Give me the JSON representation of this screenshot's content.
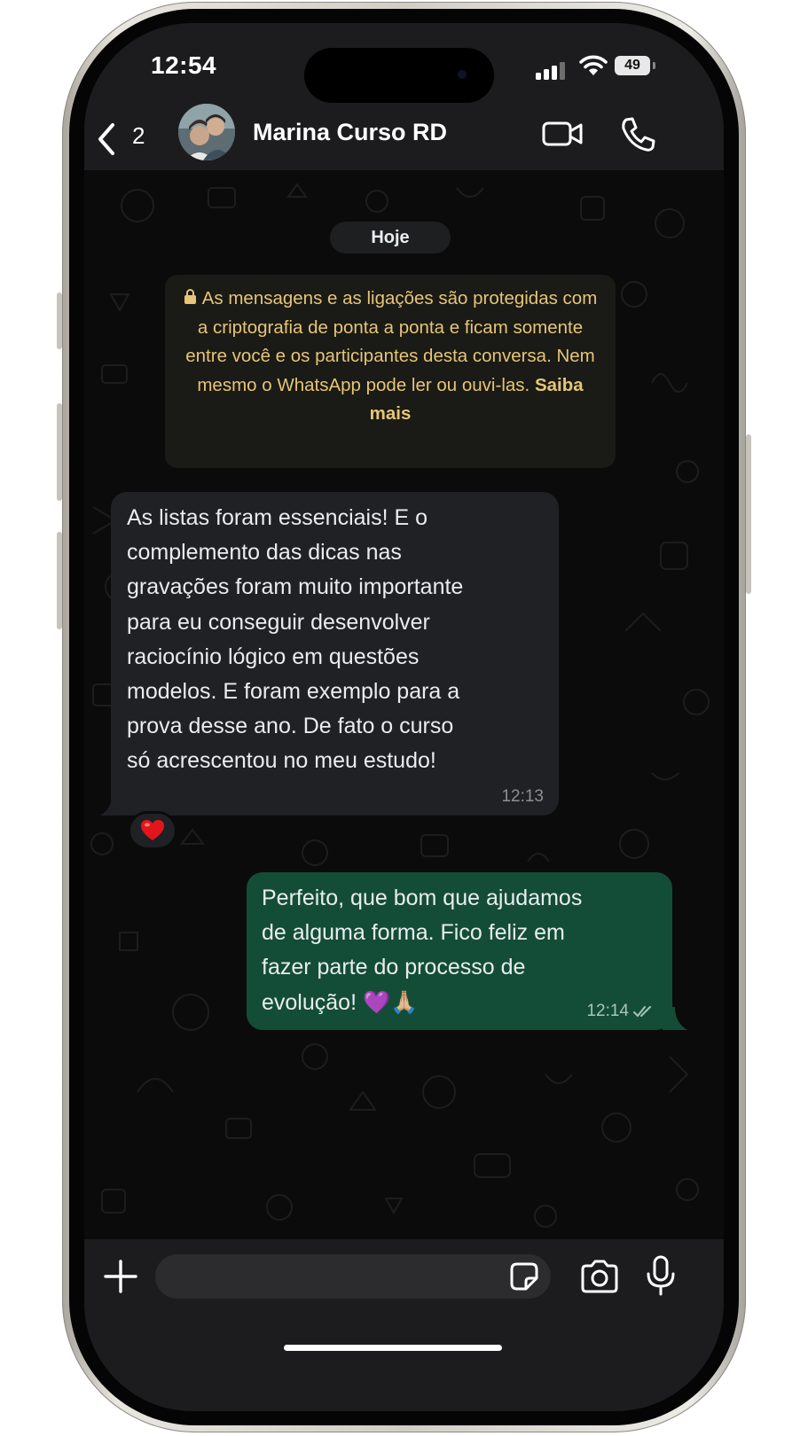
{
  "status_bar": {
    "time": "12:54",
    "battery": "49"
  },
  "header": {
    "back_count": "2",
    "contact_name": "Marina Curso RD"
  },
  "chat": {
    "date_label": "Hoje",
    "encryption_notice": {
      "text": "As mensagens e as ligações são protegidas com a criptografia de ponta a ponta e ficam somente entre você e os participantes desta conversa. Nem mesmo o WhatsApp pode ler ou ouvi-las.",
      "link": "Saiba mais"
    },
    "messages": [
      {
        "direction": "incoming",
        "text": "As listas foram essenciais! E o\ncomplemento das dicas nas\ngravações foram muito importante\npara eu conseguir desenvolver\nraciocínio lógico em questões\nmodelos. E foram exemplo para a\nprova desse ano. De fato o curso\nsó  acrescentou no meu estudo!",
        "time": "12:13",
        "reaction": "❤️"
      },
      {
        "direction": "outgoing",
        "text": "Perfeito, que bom que ajudamos\nde alguma forma. Fico feliz em\nfazer parte do processo de\nevolução! 💜🙏🏼",
        "time": "12:14",
        "status": "read"
      }
    ]
  },
  "input": {
    "placeholder": ""
  },
  "colors": {
    "incoming_bubble": "#1f2124",
    "outgoing_bubble": "#144d37",
    "notice_text": "#e6c575"
  }
}
